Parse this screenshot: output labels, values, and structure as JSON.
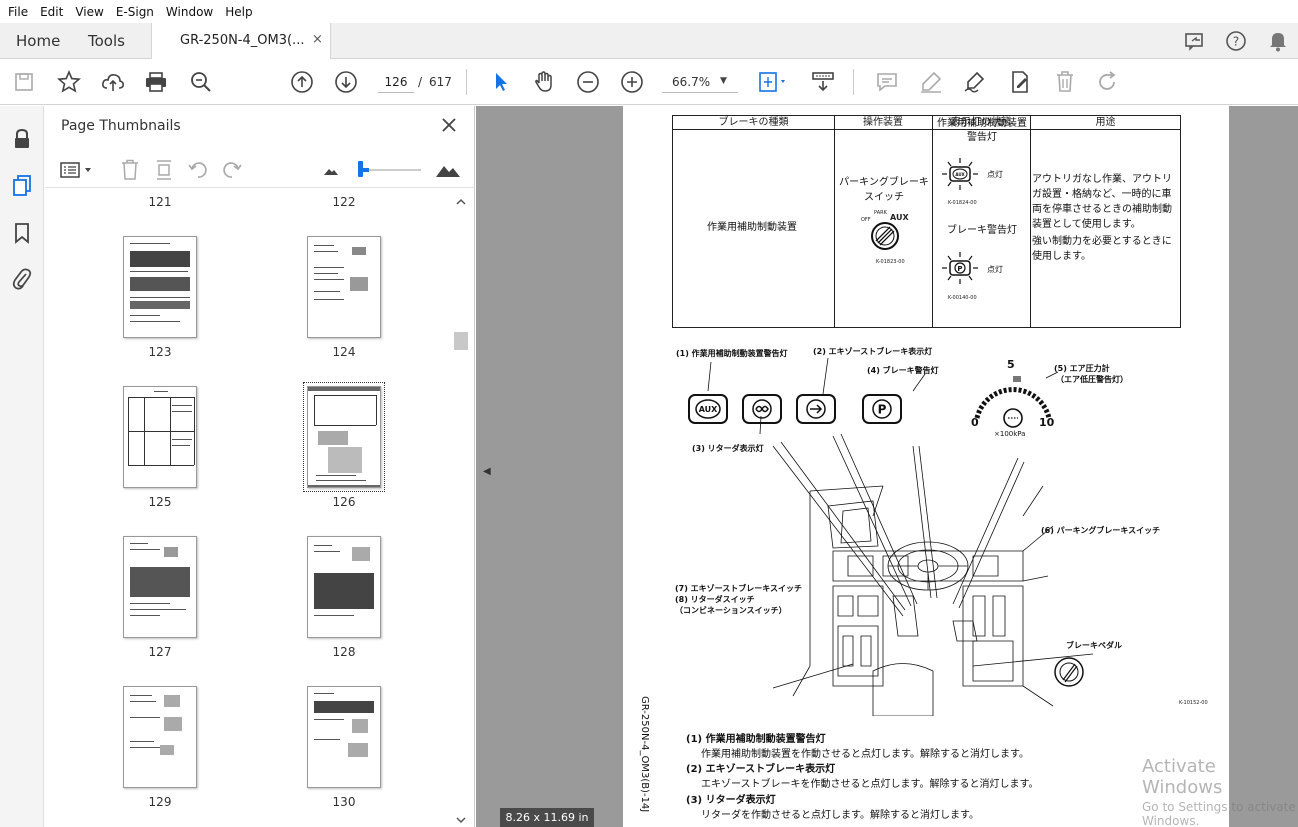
{
  "menu": [
    "File",
    "Edit",
    "View",
    "E-Sign",
    "Window",
    "Help"
  ],
  "tabs": {
    "home": "Home",
    "tools": "Tools",
    "document": "GR-250N-4_OM3(...",
    "close": "×"
  },
  "toolbar": {
    "current_page": "126",
    "page_sep": "/",
    "total_pages": "617",
    "zoom": "66.7%"
  },
  "thumbnails": {
    "title": "Page Thumbnails",
    "labels": [
      "121",
      "122",
      "123",
      "124",
      "125",
      "126",
      "127",
      "128",
      "129",
      "130"
    ],
    "selected": "126"
  },
  "document": {
    "page_size": "8.26 x 11.69 in",
    "table": {
      "headers": [
        "ブレーキの種類",
        "操作装置",
        "表示灯の状態",
        "用途"
      ],
      "brake_type": "作業用補助制動装置",
      "device": [
        "パーキングブレーキ",
        "スイッチ"
      ],
      "switch_labels": {
        "park": "PARK",
        "off": "OFF",
        "aux": "AUX"
      },
      "switch_code": "K-01823-00",
      "lamp1_title": [
        "作業用補助制動装置",
        "警告灯"
      ],
      "lamp1_code": "K-01824-00",
      "lamp_on": "点灯",
      "lamp2_title": "ブレーキ警告灯",
      "lamp2_code": "K-00140-00",
      "usage": [
        "アウトリガなし作業、アウトリ",
        "ガ設置・格納など、一時的に車",
        "両を停車させるときの補助制動",
        "装置として使用します。",
        "強い制動力を必要とするときに",
        "使用します。"
      ]
    },
    "callouts": {
      "c1": "(1) 作業用補助制動装置警告灯",
      "c2": "(2) エキゾーストブレーキ表示灯",
      "c3": "(3) リターダ表示灯",
      "c4": "(4) ブレーキ警告灯",
      "c5a": "(5) エア圧力計",
      "c5b": "（エア低圧警告灯）",
      "c6": "(6) パーキングブレーキスイッチ",
      "c7": "(7) エキゾーストブレーキスイッチ",
      "c8": "(8) リターダスイッチ",
      "c8b": "（コンビネーションスイッチ）",
      "pedal": "ブレーキペダル",
      "gauge_max": "10",
      "gauge_mid": "5",
      "gauge_min": "0",
      "gauge_unit": "×100kPa",
      "fig_code": "K-10152-00",
      "icon_aux": "AUX",
      "icon_p": "P"
    },
    "vertical_code": "GR-250N-4_OM3(B)-14J",
    "descriptions": [
      {
        "head": "(1) 作業用補助制動装置警告灯",
        "text": "作業用補助制動装置を作動させると点灯します。解除すると消灯します。"
      },
      {
        "head": "(2) エキゾーストブレーキ表示灯",
        "text": "エキゾーストブレーキを作動させると点灯します。解除すると消灯します。"
      },
      {
        "head": "(3) リターダ表示灯",
        "text": "リターダを作動させると点灯します。解除すると消灯します。"
      }
    ]
  },
  "watermark": {
    "line1": "Activate Windows",
    "line2": "Go to Settings to activate Windows."
  },
  "colors": {
    "accent": "#1473e6",
    "doc_bg": "#9a9a9a"
  }
}
